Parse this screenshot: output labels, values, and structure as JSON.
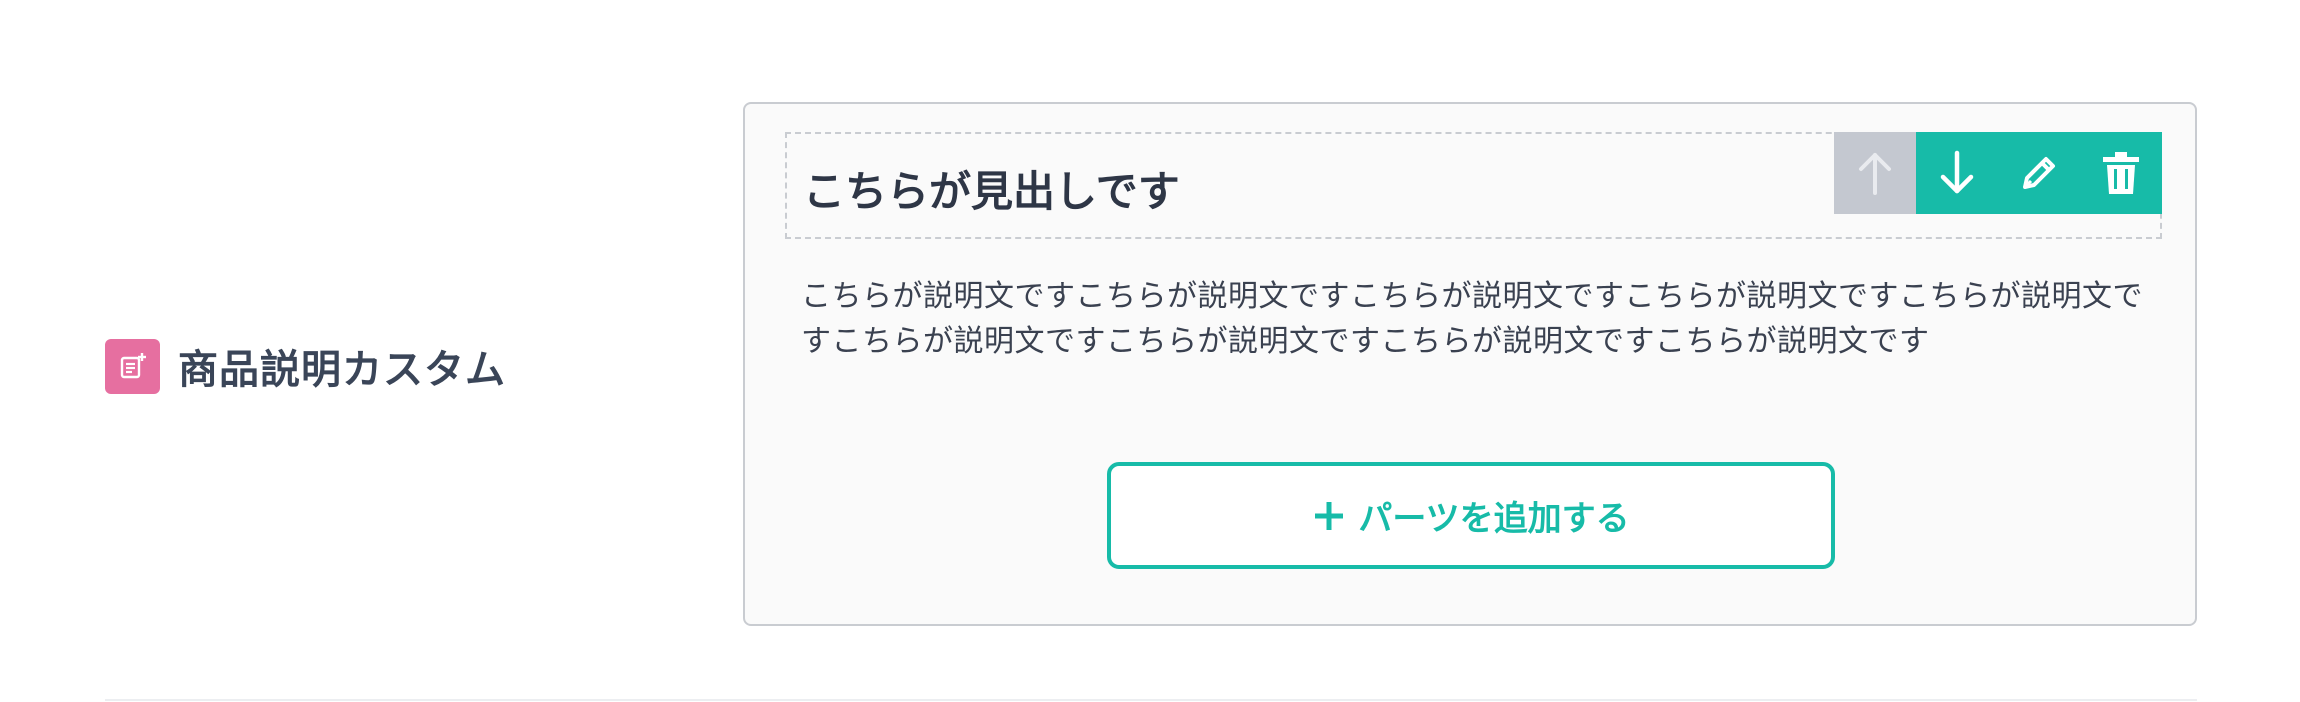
{
  "field": {
    "title": "商品説明カスタム",
    "icon": "document-add-icon",
    "icon_color": "#e66fa0"
  },
  "editor": {
    "heading": "こちらが見出しです",
    "description": "こちらが説明文ですこちらが説明文ですこちらが説明文ですこちらが説明文ですこちらが説明文ですこちらが説明文ですこちらが説明文ですこちらが説明文ですこちらが説明文です",
    "toolbar": [
      {
        "name": "move-up",
        "icon": "arrow-up-icon",
        "enabled": false
      },
      {
        "name": "move-down",
        "icon": "arrow-down-icon",
        "enabled": true
      },
      {
        "name": "edit",
        "icon": "pencil-icon",
        "enabled": true
      },
      {
        "name": "delete",
        "icon": "trash-icon",
        "enabled": true
      }
    ],
    "add_button_label": "パーツを追加する",
    "accent_color": "#17bba8"
  }
}
